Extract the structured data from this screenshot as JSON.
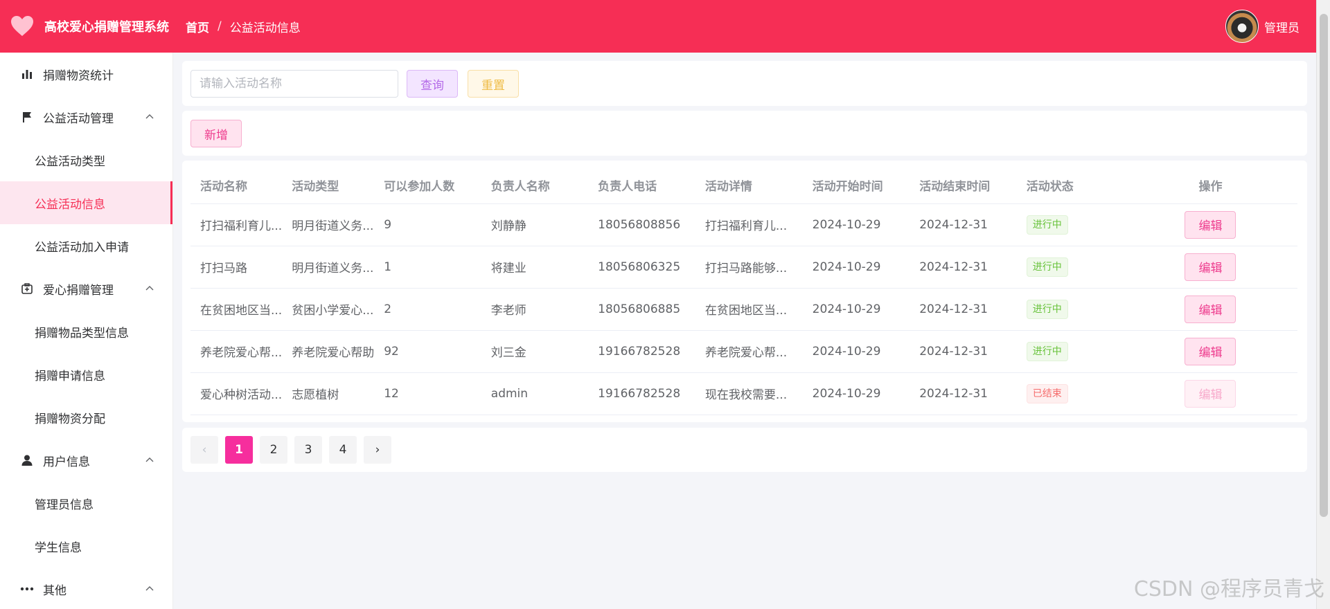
{
  "header": {
    "app_title": "高校爱心捐赠管理系统",
    "breadcrumb_home": "首页",
    "breadcrumb_sep": "/",
    "breadcrumb_current": "公益活动信息",
    "user_name": "管理员"
  },
  "sidebar": {
    "stats": "捐赠物资统计",
    "activity_group": "公益活动管理",
    "activity_type": "公益活动类型",
    "activity_info": "公益活动信息",
    "activity_join": "公益活动加入申请",
    "donation_group": "爱心捐赠管理",
    "donation_item_type": "捐赠物品类型信息",
    "donation_apply": "捐赠申请信息",
    "donation_alloc": "捐赠物资分配",
    "user_group": "用户信息",
    "admin_info": "管理员信息",
    "student_info": "学生信息",
    "other_group": "其他"
  },
  "search": {
    "placeholder": "请输入活动名称",
    "query_label": "查询",
    "reset_label": "重置"
  },
  "toolbar": {
    "add_label": "新增"
  },
  "table": {
    "headers": [
      "活动名称",
      "活动类型",
      "可以参加人数",
      "负责人名称",
      "负责人电话",
      "活动详情",
      "活动开始时间",
      "活动结束时间",
      "活动状态",
      "操作"
    ],
    "rows": [
      {
        "name": "打扫福利育儿...",
        "type": "明月街道义务...",
        "count": "9",
        "leader": "刘静静",
        "phone": "18056808856",
        "detail": "打扫福利育儿...",
        "start": "2024-10-29",
        "end": "2024-12-31",
        "status": "进行中",
        "action": "编辑"
      },
      {
        "name": "打扫马路",
        "type": "明月街道义务...",
        "count": "1",
        "leader": "将建业",
        "phone": "18056806325",
        "detail": "打扫马路能够...",
        "start": "2024-10-29",
        "end": "2024-12-31",
        "status": "进行中",
        "action": "编辑"
      },
      {
        "name": "在贫困地区当...",
        "type": "贫困小学爱心...",
        "count": "2",
        "leader": "李老师",
        "phone": "18056806885",
        "detail": "在贫困地区当...",
        "start": "2024-10-29",
        "end": "2024-12-31",
        "status": "进行中",
        "action": "编辑"
      },
      {
        "name": "养老院爱心帮...",
        "type": "养老院爱心帮助",
        "count": "92",
        "leader": "刘三金",
        "phone": "19166782528",
        "detail": "养老院爱心帮...",
        "start": "2024-10-29",
        "end": "2024-12-31",
        "status": "进行中",
        "action": "编辑"
      },
      {
        "name": "爱心种树活动...",
        "type": "志愿植树",
        "count": "12",
        "leader": "admin",
        "phone": "19166782528",
        "detail": "现在我校需要...",
        "start": "2024-10-29",
        "end": "2024-12-31",
        "status": "已结束",
        "action": "编辑"
      }
    ]
  },
  "pager": {
    "prev": "‹",
    "pages": [
      "1",
      "2",
      "3",
      "4"
    ],
    "next": "›",
    "current": "1"
  },
  "watermark": "CSDN @程序员青戈",
  "colors": {
    "brand": "#f62e55",
    "active_menu_bg": "#fde6ef",
    "page_active": "#f62e9d"
  },
  "icons": {
    "logo": "heart-icon",
    "stats": "bar-chart-icon",
    "activity": "flag-icon",
    "donation": "medical-box-icon",
    "user": "person-icon",
    "other": "more-icon"
  }
}
